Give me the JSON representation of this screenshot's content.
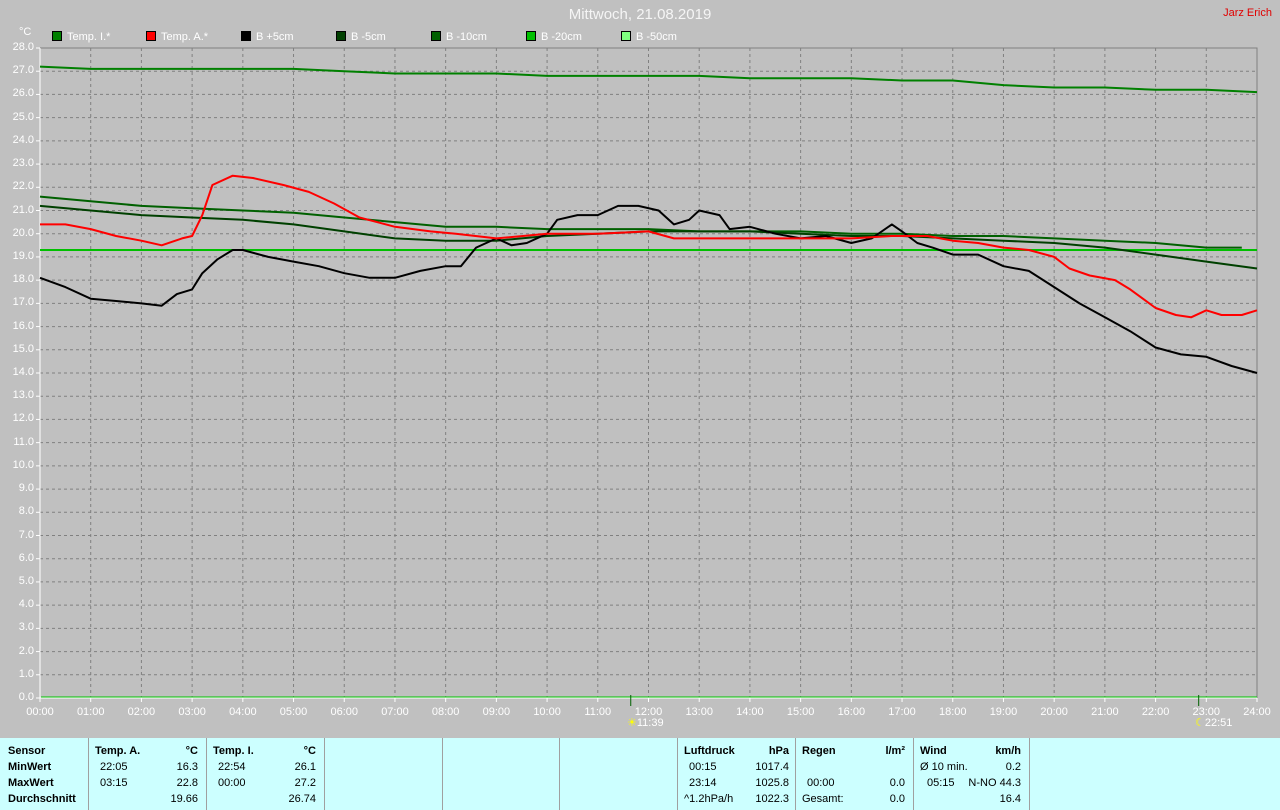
{
  "title": "Mittwoch, 21.08.2019",
  "author": "Jarz Erich",
  "colors": {
    "background": "#c0c0c0",
    "table_background": "#ccffff",
    "grid": "#808080"
  },
  "legend": [
    {
      "label": "Temp. I.*",
      "color": "#008000"
    },
    {
      "label": "Temp. A.*",
      "color": "#ff0000"
    },
    {
      "label": "B +5cm",
      "color": "#000000"
    },
    {
      "label": "B -5cm",
      "color": "#004000"
    },
    {
      "label": "B -10cm",
      "color": "#006000"
    },
    {
      "label": "B -20cm",
      "color": "#00c000"
    },
    {
      "label": "B -50cm",
      "color": "#80ff80"
    }
  ],
  "events": [
    {
      "label": "11:39",
      "icon": "sun-icon"
    },
    {
      "label": "22:51",
      "icon": "moon-icon"
    }
  ],
  "chart_data": {
    "type": "line",
    "y_unit": "°C",
    "ylim": [
      0,
      28
    ],
    "yticks": [
      "0.0",
      "1.0",
      "2.0",
      "3.0",
      "4.0",
      "5.0",
      "6.0",
      "7.0",
      "8.0",
      "9.0",
      "10.0",
      "11.0",
      "12.0",
      "13.0",
      "14.0",
      "15.0",
      "16.0",
      "17.0",
      "18.0",
      "19.0",
      "20.0",
      "21.0",
      "22.0",
      "23.0",
      "24.0",
      "25.0",
      "26.0",
      "27.0",
      "28.0"
    ],
    "xticks": [
      "00:00",
      "01:00",
      "02:00",
      "03:00",
      "04:00",
      "05:00",
      "06:00",
      "07:00",
      "08:00",
      "09:00",
      "10:00",
      "11:00",
      "12:00",
      "13:00",
      "14:00",
      "15:00",
      "16:00",
      "17:00",
      "18:00",
      "19:00",
      "20:00",
      "21:00",
      "22:00",
      "23:00",
      "24:00"
    ],
    "xlim": [
      0,
      24
    ],
    "grid": true,
    "series": [
      {
        "name": "Temp. I.*",
        "color": "#008000",
        "points": [
          [
            0,
            27.2
          ],
          [
            1,
            27.1
          ],
          [
            2,
            27.1
          ],
          [
            3,
            27.1
          ],
          [
            4,
            27.1
          ],
          [
            5,
            27.1
          ],
          [
            6,
            27.0
          ],
          [
            7,
            26.9
          ],
          [
            8,
            26.9
          ],
          [
            9,
            26.9
          ],
          [
            10,
            26.8
          ],
          [
            11,
            26.8
          ],
          [
            12,
            26.8
          ],
          [
            13,
            26.8
          ],
          [
            14,
            26.7
          ],
          [
            15,
            26.7
          ],
          [
            16,
            26.7
          ],
          [
            17,
            26.6
          ],
          [
            18,
            26.6
          ],
          [
            19,
            26.4
          ],
          [
            20,
            26.3
          ],
          [
            21,
            26.3
          ],
          [
            22,
            26.2
          ],
          [
            23,
            26.2
          ],
          [
            24,
            26.1
          ]
        ]
      },
      {
        "name": "Temp. A.*",
        "color": "#ff0000",
        "points": [
          [
            0,
            20.4
          ],
          [
            0.5,
            20.4
          ],
          [
            1,
            20.2
          ],
          [
            1.5,
            19.9
          ],
          [
            2,
            19.7
          ],
          [
            2.4,
            19.5
          ],
          [
            2.8,
            19.8
          ],
          [
            3,
            19.9
          ],
          [
            3.2,
            20.8
          ],
          [
            3.4,
            22.1
          ],
          [
            3.8,
            22.5
          ],
          [
            4.2,
            22.4
          ],
          [
            4.8,
            22.1
          ],
          [
            5.3,
            21.8
          ],
          [
            5.8,
            21.3
          ],
          [
            6.3,
            20.7
          ],
          [
            7,
            20.3
          ],
          [
            7.7,
            20.1
          ],
          [
            8.2,
            20.0
          ],
          [
            9,
            19.8
          ],
          [
            10,
            20.0
          ],
          [
            11,
            20.0
          ],
          [
            12,
            20.1
          ],
          [
            12.5,
            19.8
          ],
          [
            13,
            19.8
          ],
          [
            14,
            19.8
          ],
          [
            15,
            19.8
          ],
          [
            16,
            19.8
          ],
          [
            16.8,
            19.9
          ],
          [
            17.5,
            19.9
          ],
          [
            18,
            19.7
          ],
          [
            18.5,
            19.6
          ],
          [
            19,
            19.4
          ],
          [
            19.5,
            19.3
          ],
          [
            20,
            19.0
          ],
          [
            20.3,
            18.5
          ],
          [
            20.7,
            18.2
          ],
          [
            21.2,
            18.0
          ],
          [
            21.5,
            17.6
          ],
          [
            22,
            16.8
          ],
          [
            22.4,
            16.5
          ],
          [
            22.7,
            16.4
          ],
          [
            23,
            16.7
          ],
          [
            23.3,
            16.5
          ],
          [
            23.7,
            16.5
          ],
          [
            24,
            16.7
          ]
        ]
      },
      {
        "name": "B +5cm",
        "color": "#000000",
        "points": [
          [
            0,
            18.1
          ],
          [
            0.5,
            17.7
          ],
          [
            1,
            17.2
          ],
          [
            1.5,
            17.1
          ],
          [
            2,
            17.0
          ],
          [
            2.4,
            16.9
          ],
          [
            2.7,
            17.4
          ],
          [
            3,
            17.6
          ],
          [
            3.2,
            18.3
          ],
          [
            3.5,
            18.9
          ],
          [
            3.8,
            19.3
          ],
          [
            4,
            19.3
          ],
          [
            4.5,
            19.0
          ],
          [
            5,
            18.8
          ],
          [
            5.5,
            18.6
          ],
          [
            6,
            18.3
          ],
          [
            6.5,
            18.1
          ],
          [
            7,
            18.1
          ],
          [
            7.5,
            18.4
          ],
          [
            8,
            18.6
          ],
          [
            8.3,
            18.6
          ],
          [
            8.6,
            19.4
          ],
          [
            9,
            19.8
          ],
          [
            9.3,
            19.5
          ],
          [
            9.6,
            19.6
          ],
          [
            10,
            20.0
          ],
          [
            10.2,
            20.6
          ],
          [
            10.6,
            20.8
          ],
          [
            11,
            20.8
          ],
          [
            11.4,
            21.2
          ],
          [
            11.8,
            21.2
          ],
          [
            12.2,
            21.0
          ],
          [
            12.5,
            20.4
          ],
          [
            12.8,
            20.6
          ],
          [
            13,
            21.0
          ],
          [
            13.4,
            20.8
          ],
          [
            13.6,
            20.2
          ],
          [
            14,
            20.3
          ],
          [
            14.5,
            20.0
          ],
          [
            15,
            19.8
          ],
          [
            15.5,
            19.9
          ],
          [
            16,
            19.6
          ],
          [
            16.4,
            19.8
          ],
          [
            16.8,
            20.4
          ],
          [
            17,
            20.1
          ],
          [
            17.3,
            19.6
          ],
          [
            17.6,
            19.4
          ],
          [
            18,
            19.1
          ],
          [
            18.5,
            19.1
          ],
          [
            19,
            18.6
          ],
          [
            19.5,
            18.4
          ],
          [
            20,
            17.7
          ],
          [
            20.5,
            17.0
          ],
          [
            21,
            16.4
          ],
          [
            21.5,
            15.8
          ],
          [
            22,
            15.1
          ],
          [
            22.5,
            14.8
          ],
          [
            23,
            14.7
          ],
          [
            23.5,
            14.3
          ],
          [
            24,
            14.0
          ]
        ]
      },
      {
        "name": "B -5cm",
        "color": "#004000",
        "points": [
          [
            0,
            21.2
          ],
          [
            1,
            21.0
          ],
          [
            2,
            20.8
          ],
          [
            3,
            20.7
          ],
          [
            4,
            20.6
          ],
          [
            5,
            20.4
          ],
          [
            6,
            20.1
          ],
          [
            7,
            19.8
          ],
          [
            8,
            19.7
          ],
          [
            9,
            19.7
          ],
          [
            10,
            19.9
          ],
          [
            11,
            20.0
          ],
          [
            12,
            20.1
          ],
          [
            13,
            20.1
          ],
          [
            14,
            20.1
          ],
          [
            15,
            20.0
          ],
          [
            16,
            19.9
          ],
          [
            17,
            19.9
          ],
          [
            18,
            19.8
          ],
          [
            19,
            19.7
          ],
          [
            20,
            19.6
          ],
          [
            21,
            19.4
          ],
          [
            22,
            19.1
          ],
          [
            23,
            18.8
          ],
          [
            24,
            18.5
          ]
        ]
      },
      {
        "name": "B -10cm",
        "color": "#006000",
        "points": [
          [
            0,
            21.6
          ],
          [
            1,
            21.4
          ],
          [
            2,
            21.2
          ],
          [
            3,
            21.1
          ],
          [
            4,
            21.0
          ],
          [
            5,
            20.9
          ],
          [
            6,
            20.7
          ],
          [
            7,
            20.5
          ],
          [
            8,
            20.3
          ],
          [
            9,
            20.3
          ],
          [
            10,
            20.2
          ],
          [
            11,
            20.2
          ],
          [
            12,
            20.2
          ],
          [
            13,
            20.1
          ],
          [
            14,
            20.1
          ],
          [
            15,
            20.1
          ],
          [
            16,
            20.0
          ],
          [
            17,
            20.0
          ],
          [
            18,
            19.9
          ],
          [
            19,
            19.9
          ],
          [
            20,
            19.8
          ],
          [
            21,
            19.7
          ],
          [
            22,
            19.6
          ],
          [
            23,
            19.4
          ],
          [
            23.7,
            19.4
          ]
        ]
      },
      {
        "name": "B -20cm",
        "color": "#00c000",
        "points": [
          [
            0,
            19.3
          ],
          [
            4,
            19.3
          ],
          [
            8,
            19.3
          ],
          [
            12,
            19.3
          ],
          [
            16,
            19.3
          ],
          [
            20,
            19.3
          ],
          [
            24,
            19.3
          ]
        ]
      },
      {
        "name": "B -50cm",
        "color": "#80ff80",
        "points": []
      }
    ]
  },
  "table": {
    "sensor": {
      "header": "Sensor",
      "min_label": "MinWert",
      "max_label": "MaxWert",
      "avg_label": "Durchschnitt"
    },
    "temp_a": {
      "header": "Temp. A.",
      "unit": "°C",
      "min_time": "22:05",
      "min_val": "16.3",
      "max_time": "03:15",
      "max_val": "22.8",
      "avg": "19.66"
    },
    "temp_i": {
      "header": "Temp. I.",
      "unit": "°C",
      "min_time": "22:54",
      "min_val": "26.1",
      "max_time": "00:00",
      "max_val": "27.2",
      "avg": "26.74"
    },
    "pressure": {
      "header": "Luftdruck",
      "unit": "hPa",
      "min_time": "00:15",
      "min_val": "1017.4",
      "max_time": "23:14",
      "max_val": "1025.8",
      "trend_label": "^1.2hPa/h",
      "trend_val": "1022.3"
    },
    "rain": {
      "header": "Regen",
      "unit": "l/m²",
      "max_time": "00:00",
      "max_val": "0.0",
      "total_label": "Gesamt:",
      "total_val": "0.0"
    },
    "wind": {
      "header": "Wind",
      "unit": "km/h",
      "avg_label": "Ø 10 min.",
      "avg_val": "0.2",
      "max_time": "05:15",
      "max_val": "N-NO 44.3",
      "last_val": "16.4"
    }
  }
}
